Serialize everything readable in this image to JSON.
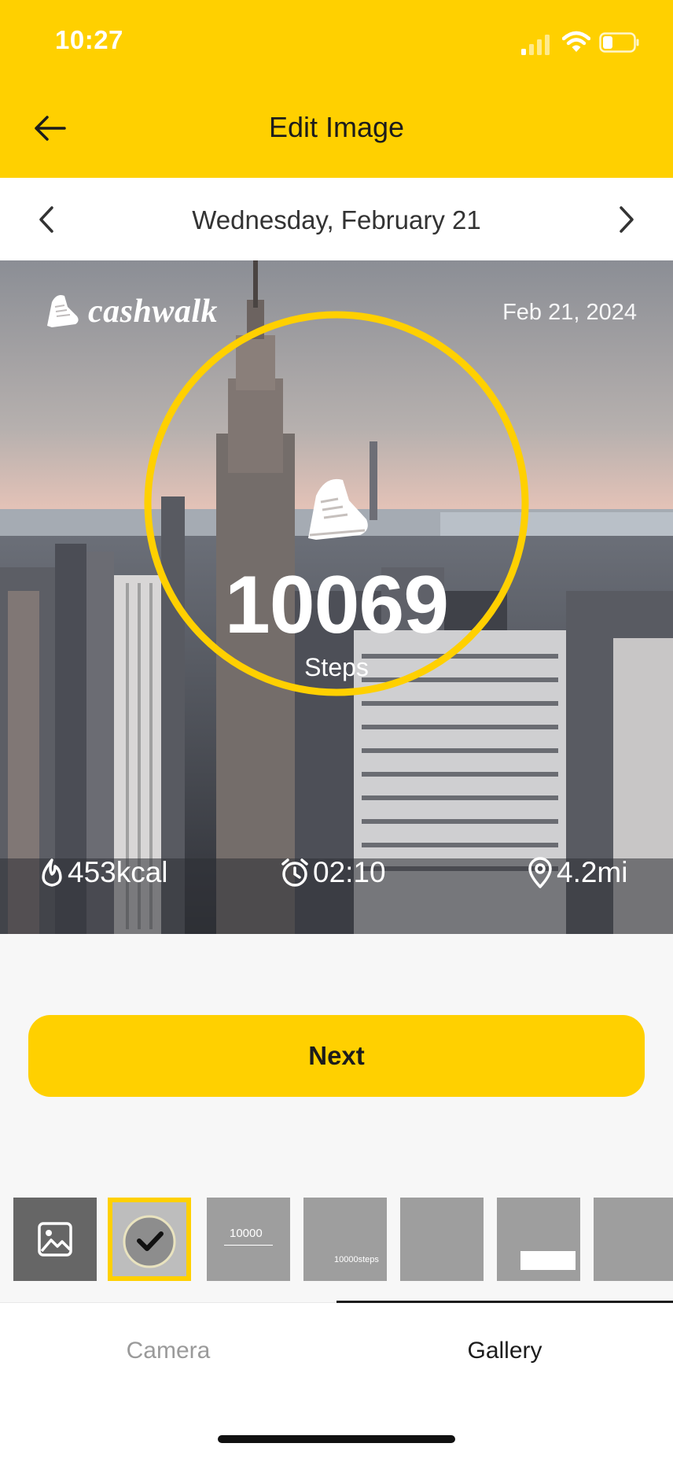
{
  "status": {
    "time": "10:27"
  },
  "header": {
    "title": "Edit Image"
  },
  "date_nav": {
    "label": "Wednesday, February 21"
  },
  "photo": {
    "brand": "cashwalk",
    "date": "Feb 21, 2024",
    "steps": "10069",
    "steps_label": "Steps",
    "calories": "453kcal",
    "duration": "02:10",
    "distance": "4.2mi"
  },
  "next_button": {
    "label": "Next"
  },
  "thumbnails": {
    "t3_big": "10000",
    "t4_big": "10000steps"
  },
  "tabs": [
    {
      "label": "Camera",
      "active": false
    },
    {
      "label": "Gallery",
      "active": true
    }
  ],
  "colors": {
    "accent": "#ffd000"
  }
}
